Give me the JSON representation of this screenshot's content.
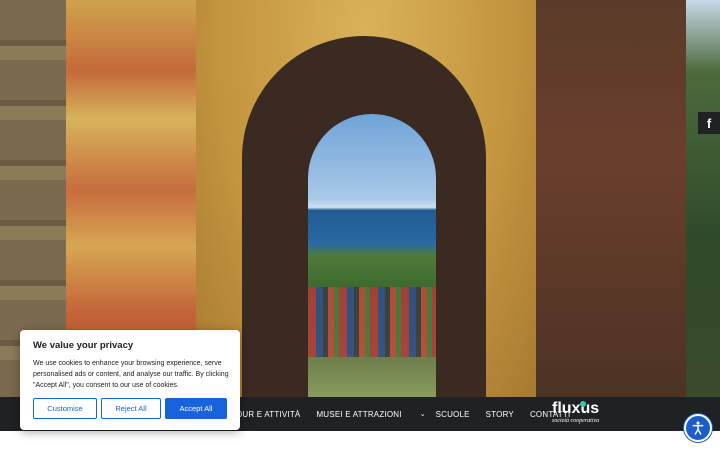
{
  "social": {
    "facebook_glyph": "f"
  },
  "nav": {
    "items": [
      {
        "label": "OUR E ATTIVITÀ"
      },
      {
        "label": "MUSEI E ATTRAZIONI",
        "has_dropdown": true
      },
      {
        "label": "SCUOLE"
      },
      {
        "label": "STORY"
      },
      {
        "label": "CONTATTI"
      }
    ]
  },
  "logo": {
    "word": "fluxus",
    "tagline": "società cooperativa",
    "dot_color": "#3cc3a4"
  },
  "cookie": {
    "title": "We value your privacy",
    "text": "We use cookies to enhance your browsing experience, serve personalised ads or content, and analyse our traffic. By clicking \"Accept All\", you consent to our use of cookies.",
    "customise_label": "Customise",
    "reject_label": "Reject All",
    "accept_label": "Accept All",
    "accent_color": "#1863dc"
  },
  "accessibility": {
    "icon": "accessibility-icon",
    "color": "#1c5ec8"
  }
}
